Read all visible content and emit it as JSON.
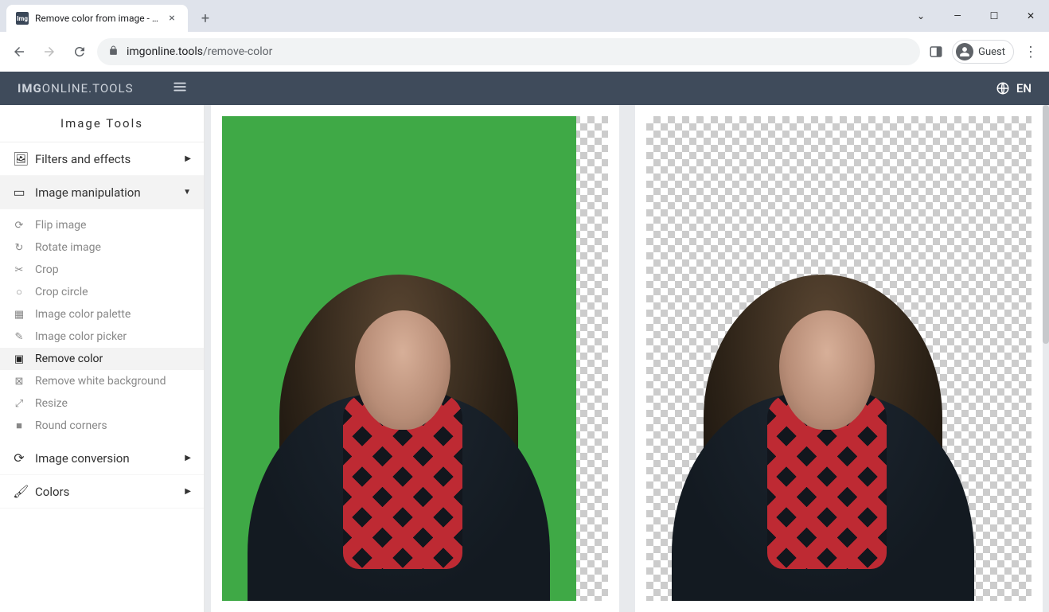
{
  "browser": {
    "tab_title": "Remove color from image - onlin",
    "url_host": "imgonline.tools",
    "url_path": "/remove-color",
    "guest": "Guest"
  },
  "header": {
    "brand_bold": "IMG",
    "brand_rest": "ONLINE.TOOLS",
    "lang": "EN"
  },
  "sidebar": {
    "title": "Image Tools",
    "categories": {
      "filters": {
        "label": "Filters and effects"
      },
      "manip": {
        "label": "Image manipulation"
      },
      "conv": {
        "label": "Image conversion"
      },
      "colors": {
        "label": "Colors"
      }
    },
    "manip_items": {
      "flip": "Flip image",
      "rotate": "Rotate image",
      "crop": "Crop",
      "cropcircle": "Crop circle",
      "palette": "Image color palette",
      "picker": "Image color picker",
      "removecolor": "Remove color",
      "removewhite": "Remove white background",
      "resize": "Resize",
      "round": "Round corners"
    }
  }
}
